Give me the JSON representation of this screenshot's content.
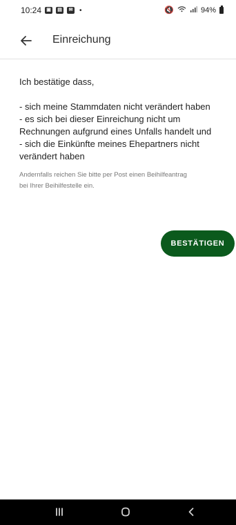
{
  "status_bar": {
    "time": "10:24",
    "battery": "94%",
    "icons": [
      "calendar-notification-icon",
      "photo-notification-icon",
      "mail-notification-icon",
      "mute-icon",
      "wifi-icon",
      "signal-icon",
      "battery-icon"
    ]
  },
  "app_bar": {
    "title": "Einreichung",
    "back_icon": "arrow-left-icon"
  },
  "content": {
    "intro": "Ich bestätige dass,",
    "items": [
      "- sich meine Stammdaten nicht verändert haben",
      "- es sich bei dieser Einreichung nicht um",
      "Rechnungen aufgrund eines Unfalls handelt und",
      "- sich die Einkünfte meines Ehepartners nicht",
      "verändert haben"
    ],
    "notice_lines": [
      "Andernfalls reichen Sie bitte per Post einen Beihilfeantrag",
      "bei Ihrer Beihilfestelle ein."
    ]
  },
  "actions": {
    "confirm": "BESTÄTIGEN"
  },
  "navigation": {
    "icons": [
      "recent-apps-icon",
      "home-icon",
      "back-icon"
    ]
  },
  "colors": {
    "primary_button": "#0b5a1d",
    "text": "#222222",
    "secondary_text": "#777777",
    "nav_bar": "#000000"
  }
}
